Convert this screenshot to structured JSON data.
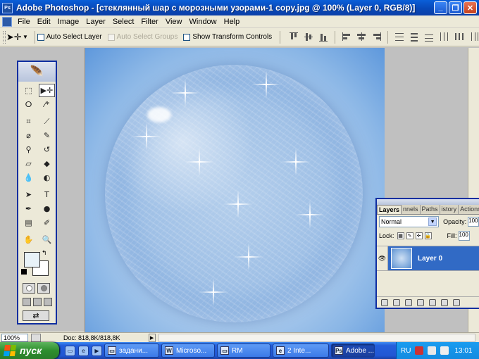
{
  "window": {
    "title": "Adobe Photoshop - [стеклянный шар с морозными узорами-1 copy.jpg @ 100% (Layer 0, RGB/8)]"
  },
  "menu": [
    "File",
    "Edit",
    "Image",
    "Layer",
    "Select",
    "Filter",
    "View",
    "Window",
    "Help"
  ],
  "options": {
    "auto_select_layer": "Auto Select Layer",
    "auto_select_groups": "Auto Select Groups",
    "show_transform_controls": "Show Transform Controls"
  },
  "toolbox": {
    "tools": [
      {
        "name": "marquee-tool-icon",
        "glyph": "⬚"
      },
      {
        "name": "move-tool-icon",
        "glyph": "▶✛"
      },
      {
        "name": "lasso-tool-icon",
        "glyph": "ⵔ"
      },
      {
        "name": "magic-wand-tool-icon",
        "glyph": "⁄*"
      },
      {
        "name": "crop-tool-icon",
        "glyph": "⌗"
      },
      {
        "name": "slice-tool-icon",
        "glyph": "⟋"
      },
      {
        "name": "healing-brush-tool-icon",
        "glyph": "⌀"
      },
      {
        "name": "brush-tool-icon",
        "glyph": "✎"
      },
      {
        "name": "clone-stamp-tool-icon",
        "glyph": "⚲"
      },
      {
        "name": "history-brush-tool-icon",
        "glyph": "↺"
      },
      {
        "name": "eraser-tool-icon",
        "glyph": "▱"
      },
      {
        "name": "paint-bucket-tool-icon",
        "glyph": "◆"
      },
      {
        "name": "blur-tool-icon",
        "glyph": "💧"
      },
      {
        "name": "dodge-tool-icon",
        "glyph": "◐"
      },
      {
        "name": "path-selection-tool-icon",
        "glyph": "➤"
      },
      {
        "name": "type-tool-icon",
        "glyph": "T"
      },
      {
        "name": "pen-tool-icon",
        "glyph": "✒"
      },
      {
        "name": "shape-tool-icon",
        "glyph": "●"
      },
      {
        "name": "notes-tool-icon",
        "glyph": "▤"
      },
      {
        "name": "eyedropper-tool-icon",
        "glyph": "✐"
      },
      {
        "name": "hand-tool-icon",
        "glyph": "✋"
      },
      {
        "name": "zoom-tool-icon",
        "glyph": "🔍"
      }
    ],
    "foreground_color": "#e8f2f8",
    "background_color": "#ffffff"
  },
  "layers_panel": {
    "tabs": [
      "Layers",
      "nnels",
      "Paths",
      "istory",
      "Actions"
    ],
    "blend_mode": "Normal",
    "opacity_label": "Opacity:",
    "opacity_value": "100",
    "lock_label": "Lock:",
    "fill_label": "Fill:",
    "fill_value": "100",
    "layer_name": "Layer 0"
  },
  "status": {
    "zoom": "100%",
    "doc": "Doc: 818,8K/818,8K"
  },
  "taskbar": {
    "start_label": "пуск",
    "tasks": [
      {
        "label": "задани...",
        "icon": "▭"
      },
      {
        "label": "Microso...",
        "icon": "W"
      },
      {
        "label": "RM",
        "icon": "▭"
      },
      {
        "label": "2 Inte...",
        "icon": "e"
      },
      {
        "label": "Adobe ...",
        "icon": "Ps"
      }
    ],
    "language": "RU",
    "clock": "13:01"
  },
  "colors": {
    "selection": "#316ac5",
    "titlebar": "#0848b8",
    "panel_border": "#0f2ea0"
  }
}
